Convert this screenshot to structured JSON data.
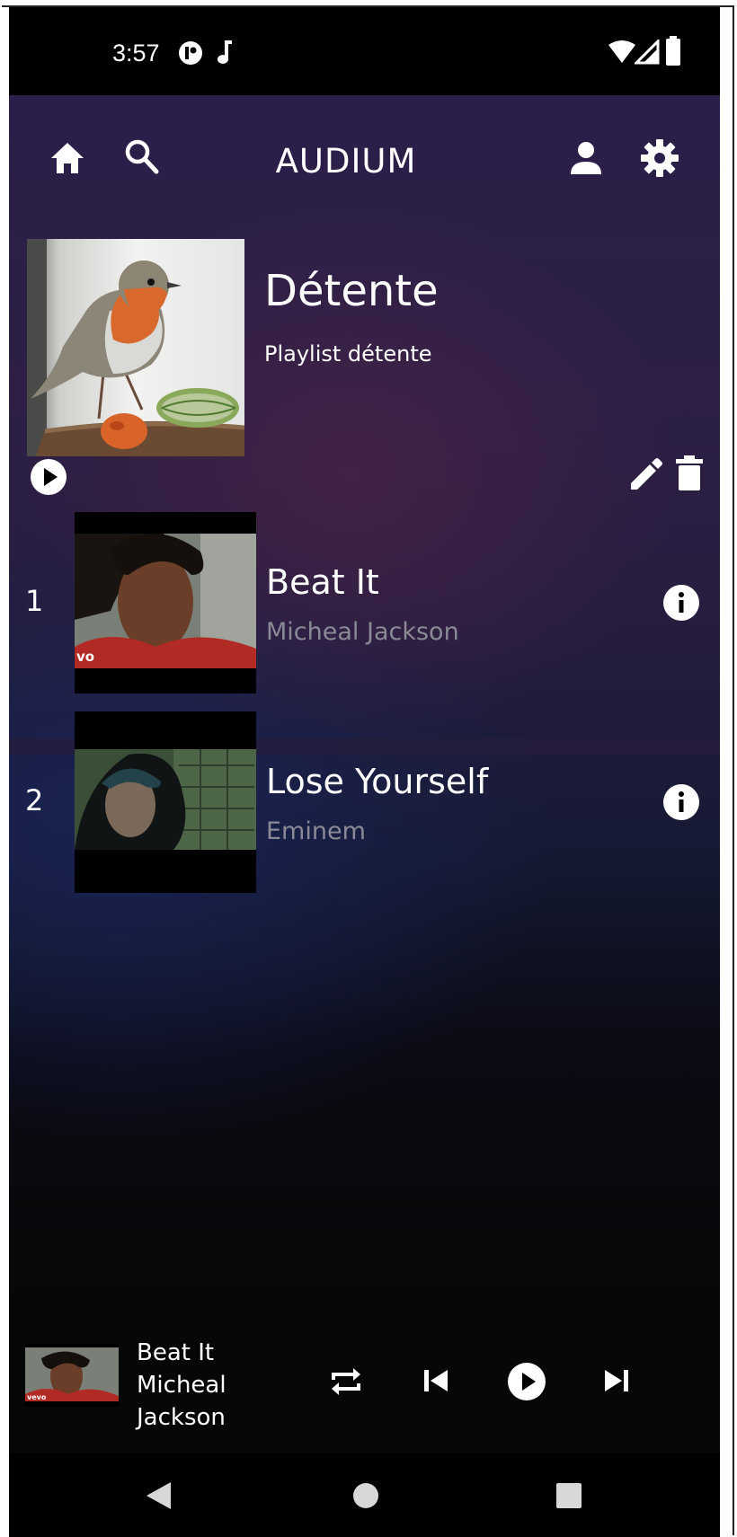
{
  "status_bar": {
    "time": "3:57",
    "left_icons": [
      "app-notification-icon",
      "music-note-icon"
    ],
    "right_icons": [
      "wifi-icon",
      "cellular-signal-icon",
      "battery-icon"
    ]
  },
  "header": {
    "title": "AUDIUM",
    "left_icons": [
      "home-icon",
      "search-icon"
    ],
    "right_icons": [
      "account-icon",
      "settings-icon"
    ]
  },
  "playlist": {
    "title": "Détente",
    "description": "Playlist détente",
    "cover_icon": "robin-bird-cover-image",
    "actions": [
      "play-circle-icon",
      "edit-pencil-icon",
      "delete-trash-icon"
    ]
  },
  "tracks": [
    {
      "number": "1",
      "title": "Beat It",
      "artist": "Micheal Jackson",
      "thumb_badge": "vo"
    },
    {
      "number": "2",
      "title": "Lose Yourself",
      "artist": "Eminem",
      "thumb_badge": ""
    }
  ],
  "mini_player": {
    "title": "Beat It",
    "artist": "Micheal Jackson",
    "thumb_badge": "vevo",
    "controls": [
      "repeat-icon",
      "skip-previous-icon",
      "play-circle-icon",
      "skip-next-icon"
    ]
  },
  "nav_bar": {
    "buttons": [
      "back-triangle-icon",
      "home-circle-icon",
      "recents-square-icon"
    ]
  },
  "colors": {
    "accent_text": "#ffffff",
    "artist_text": "#8a8a96",
    "background_dark": "#070707",
    "gradient_purple": "#2d1f45",
    "gradient_blue": "#151a33"
  }
}
